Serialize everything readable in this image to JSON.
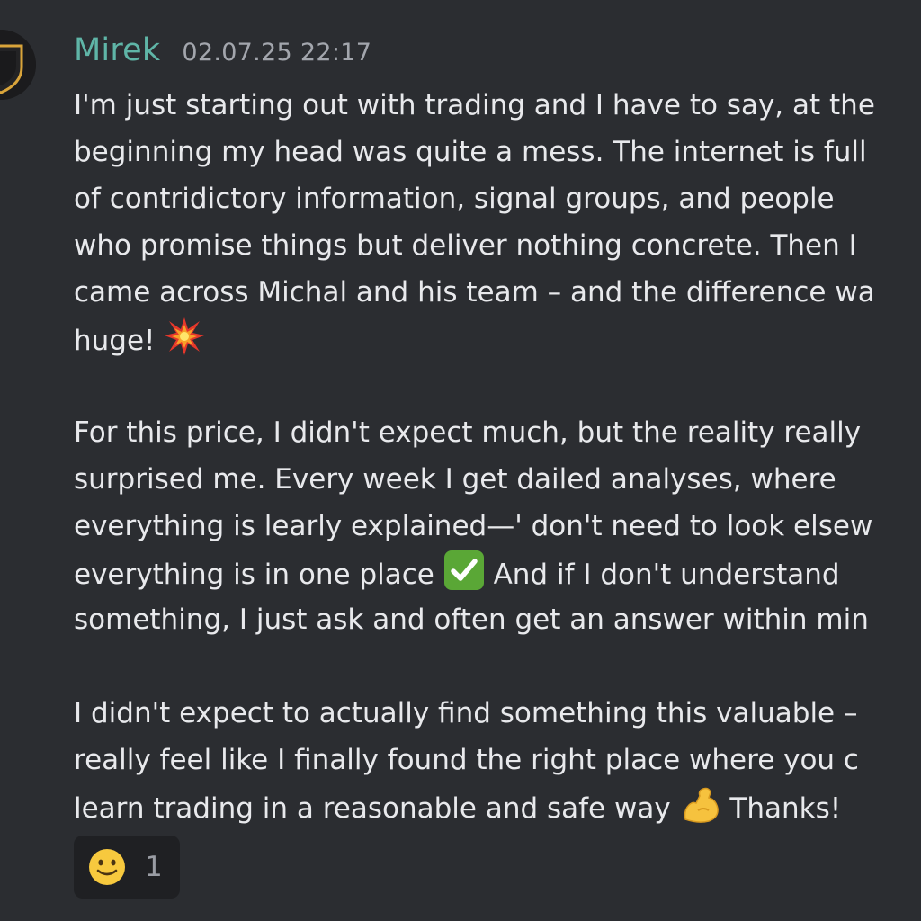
{
  "message": {
    "author": "Mirek",
    "timestamp": "02.07.25 22:17",
    "author_color": "#5fb5a7",
    "avatar_icon": "shield-logo-icon",
    "paragraphs": [
      [
        "I'm just starting out with trading and I have to say, at the",
        "beginning my head was quite a mess. The internet is full",
        "of contridictory information, signal groups, and people",
        "who promise things but deliver nothing concrete. Then I",
        "came across Michal and his team – and the difference wa",
        "huge!"
      ],
      [
        "For this price, I didn't expect much, but the reality really",
        "surprised me. Every week I get dailed analyses, where",
        "everything is learly explained—' don't need to look elsew",
        "everything is in one place",
        "And if I don't understand",
        "something, I just ask and often get an answer within min"
      ],
      [
        "I didn't expect to actually find something this valuable –",
        "really feel like I finally found the right place where you c",
        "learn trading in a reasonable and safe way",
        "Thanks!"
      ]
    ],
    "emojis": {
      "collision": "collision-emoji",
      "check": "check-mark-button-emoji",
      "flexed_bicep": "flexed-biceps-emoji"
    }
  },
  "reaction": {
    "emoji": "slightly-smiling-face-emoji",
    "count": "1"
  }
}
